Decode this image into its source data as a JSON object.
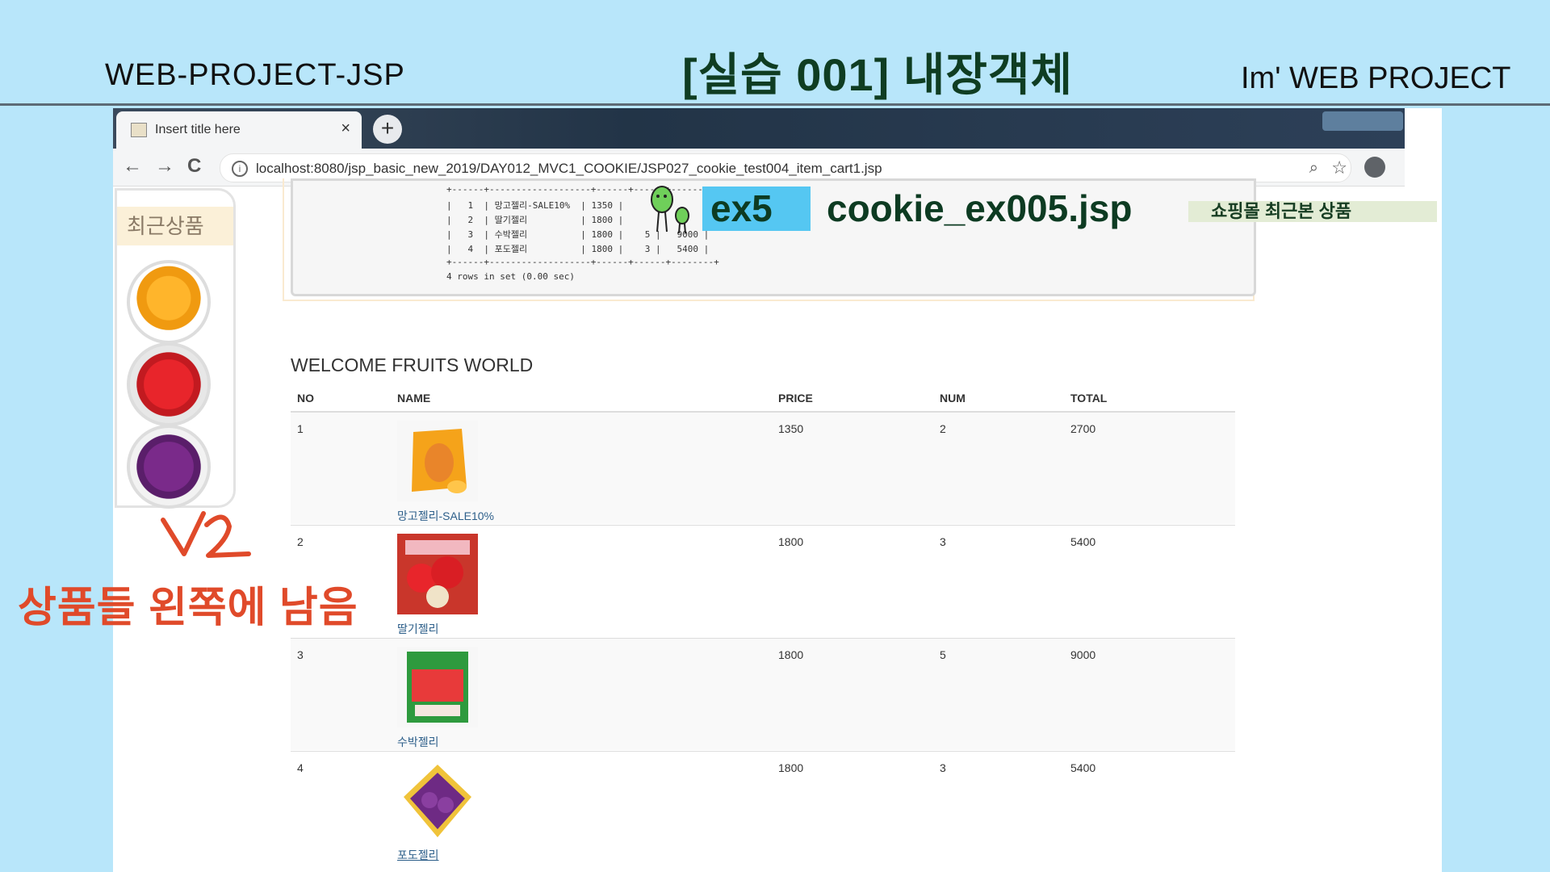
{
  "slide": {
    "left_title": "WEB-PROJECT-JSP",
    "center_title": "[실습 001]  내장객체",
    "right_title": "Im'  WEB PROJECT",
    "annotation_mark": "V2",
    "annotation_text": "상품들 왼쪽에 남음"
  },
  "browser": {
    "tab_title": "Insert title here",
    "tab_close": "×",
    "new_tab": "+",
    "back": "←",
    "forward": "→",
    "reload": "C",
    "url": "localhost:8080/jsp_basic_new_2019/DAY012_MVC1_COOKIE/JSP027_cookie_test004_item_cart1.jsp",
    "info": "i"
  },
  "sidebar": {
    "title": "최근상품",
    "items": [
      "mango",
      "strawberry",
      "grape"
    ]
  },
  "sql_output": {
    "border_top": "+------+-------------------+------+------+--------+",
    "rows": [
      "|   1  | 망고젤리-SALE10%  | 1350 |",
      "|   2  | 딸기젤리          | 1800 |",
      "|   3  | 수박젤리          | 1800 |    5 |   9000 |",
      "|   4  | 포도젤리          | 1800 |    3 |   5400 |"
    ],
    "border_bottom": "+------+-------------------+------+------+--------+",
    "footer": "4 rows in set (0.00 sec)"
  },
  "overlay": {
    "ex_label": "ex5",
    "filename": "cookie_ex005.jsp",
    "note": "쇼핑몰 최근본 상품"
  },
  "cart": {
    "heading": "WELCOME FRUITS WORLD",
    "columns": [
      "NO",
      "NAME",
      "PRICE",
      "NUM",
      "TOTAL"
    ],
    "rows": [
      {
        "no": "1",
        "name": "망고젤리-SALE10%",
        "price": "1350",
        "num": "2",
        "total": "2700"
      },
      {
        "no": "2",
        "name": "딸기젤리",
        "price": "1800",
        "num": "3",
        "total": "5400"
      },
      {
        "no": "3",
        "name": "수박젤리",
        "price": "1800",
        "num": "5",
        "total": "9000"
      },
      {
        "no": "4",
        "name": "포도젤리",
        "price": "1800",
        "num": "3",
        "total": "5400"
      }
    ]
  }
}
